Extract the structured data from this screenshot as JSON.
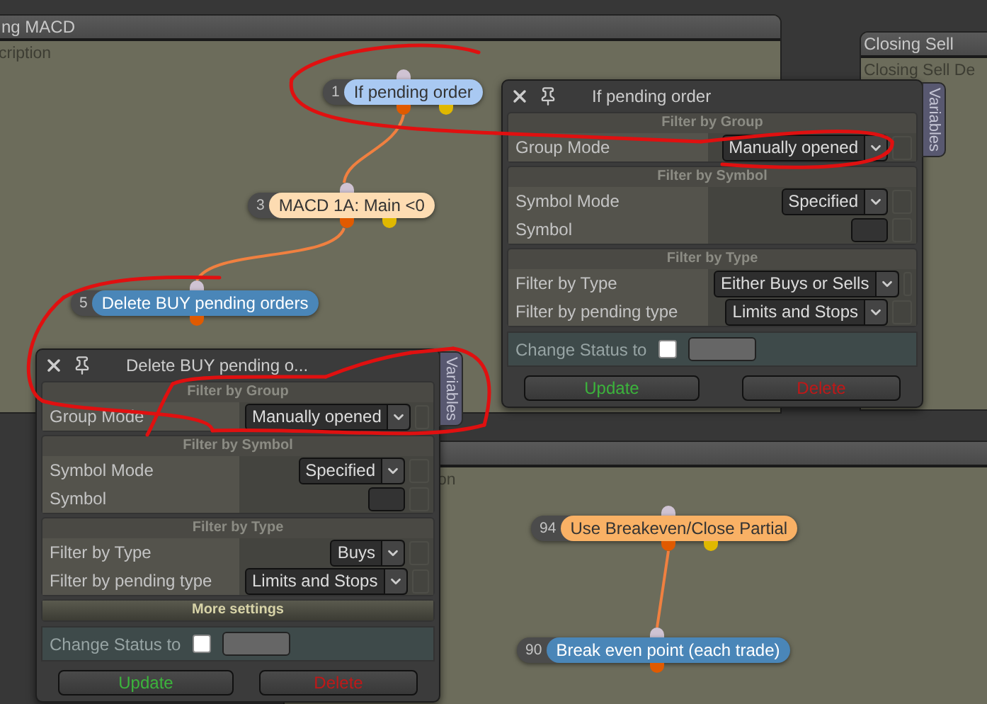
{
  "windows": [
    {
      "title": "ng MACD",
      "subtitle": "cription"
    },
    {
      "title": "Closing Sell",
      "subtitle": "Closing Sell De"
    },
    {
      "subtitle": "on"
    }
  ],
  "nodes": [
    {
      "number": "1",
      "label": "If pending order",
      "color": "#a9c9f2",
      "has_output": true
    },
    {
      "number": "3",
      "label": "MACD 1A: Main <0",
      "color": "#fddcb2",
      "has_output": true
    },
    {
      "number": "5",
      "label": "Delete BUY pending orders",
      "color": "#4a86b8",
      "has_output": false
    },
    {
      "number": "94",
      "label": "Use Breakeven/Close Partial",
      "color": "#f9b165",
      "has_output": true
    },
    {
      "number": "90",
      "label": "Break even point (each trade)",
      "color": "#4a86b8",
      "has_output": false
    }
  ],
  "dialogs": [
    {
      "title": "If pending order",
      "side_tab": "Variables",
      "sections": [
        {
          "header": "Filter by Group",
          "expanded": true,
          "rows": [
            {
              "kind": "select",
              "label": "Group Mode",
              "value": "Manually opened"
            }
          ]
        },
        {
          "header": "Filter by Symbol",
          "expanded": true,
          "rows": [
            {
              "kind": "select",
              "label": "Symbol Mode",
              "value": "Specified"
            },
            {
              "kind": "text",
              "label": "Symbol"
            }
          ]
        },
        {
          "header": "Filter by Type",
          "expanded": true,
          "rows": [
            {
              "kind": "select",
              "label": "Filter by Type",
              "value": "Either Buys or Sells"
            },
            {
              "kind": "select",
              "label": "Filter by pending type",
              "value": "Limits and Stops"
            }
          ]
        }
      ],
      "status": {
        "label": "Change Status to",
        "checked": false
      },
      "buttons": [
        "Update",
        "Delete"
      ]
    },
    {
      "title": "Delete BUY pending o...",
      "side_tab": "Variables",
      "sections": [
        {
          "header": "Filter by Group",
          "expanded": true,
          "rows": [
            {
              "kind": "select",
              "label": "Group Mode",
              "value": "Manually opened"
            }
          ]
        },
        {
          "header": "Filter by Symbol",
          "expanded": true,
          "rows": [
            {
              "kind": "select",
              "label": "Symbol Mode",
              "value": "Specified"
            },
            {
              "kind": "text",
              "label": "Symbol"
            }
          ]
        },
        {
          "header": "Filter by Type",
          "expanded": true,
          "rows": [
            {
              "kind": "select",
              "label": "Filter by Type",
              "value": "Buys"
            },
            {
              "kind": "select",
              "label": "Filter by pending type",
              "value": "Limits and Stops"
            }
          ]
        },
        {
          "header": "More settings",
          "expanded": false
        }
      ],
      "status": {
        "label": "Change Status to",
        "checked": false
      },
      "buttons": [
        "Update",
        "Delete"
      ]
    }
  ]
}
